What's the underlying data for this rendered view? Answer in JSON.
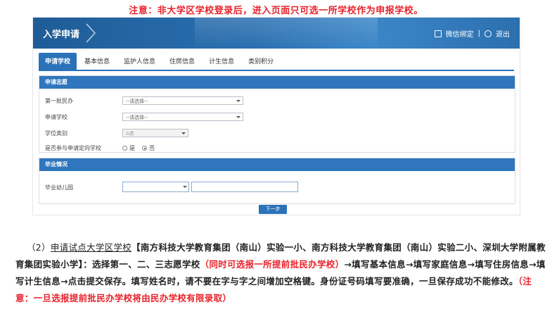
{
  "notice": "注意：非大学区学校登录后，进入页面只可选一所学校作为申报学校。",
  "header": {
    "title": "入学申请",
    "wechat": "微信绑定",
    "sep": "|",
    "logout": "退出"
  },
  "tabs": [
    "申请学校",
    "基本信息",
    "监护人信息",
    "住房信息",
    "计生信息",
    "类别积分"
  ],
  "section1": {
    "title": "申请志愿",
    "fields": [
      {
        "label": "第一批民办",
        "value": "--请选择--"
      },
      {
        "label": "申请学校",
        "value": "--请选择--"
      },
      {
        "label": "学位类别",
        "value": "A类"
      },
      {
        "label": "是否参与申请定向学校",
        "option_yes": "是",
        "option_no": "否",
        "selected": "否"
      }
    ]
  },
  "section2": {
    "title": "毕业情况",
    "field_label": "毕业幼儿园"
  },
  "next_button": "下一步",
  "paragraph": {
    "num": "（2）",
    "link": "申请试点大学区学校",
    "schools": "【南方科技大学教育集团（南山）实验一小、南方科技大学教育集团（南山）实验二小、深圳大学附属教育集团实验小学】",
    "text1": "：选择第一、二、三志愿学校",
    "red1": "（同时可选报一所提前批民办学校）",
    "text2": "→填写基本信息→填写家庭信息→填写住房信息→填写计生信息→点击提交保存。填写姓名时，请不要在字与字之间增加空格键。身份证号码填写要准确，一旦保存成功不能修改。",
    "red2": "（注意：一旦选报提前批民办学校将由民办学校有限录取）"
  },
  "colors": {
    "accent": "#2b72b8",
    "alert": "#e8232c"
  }
}
